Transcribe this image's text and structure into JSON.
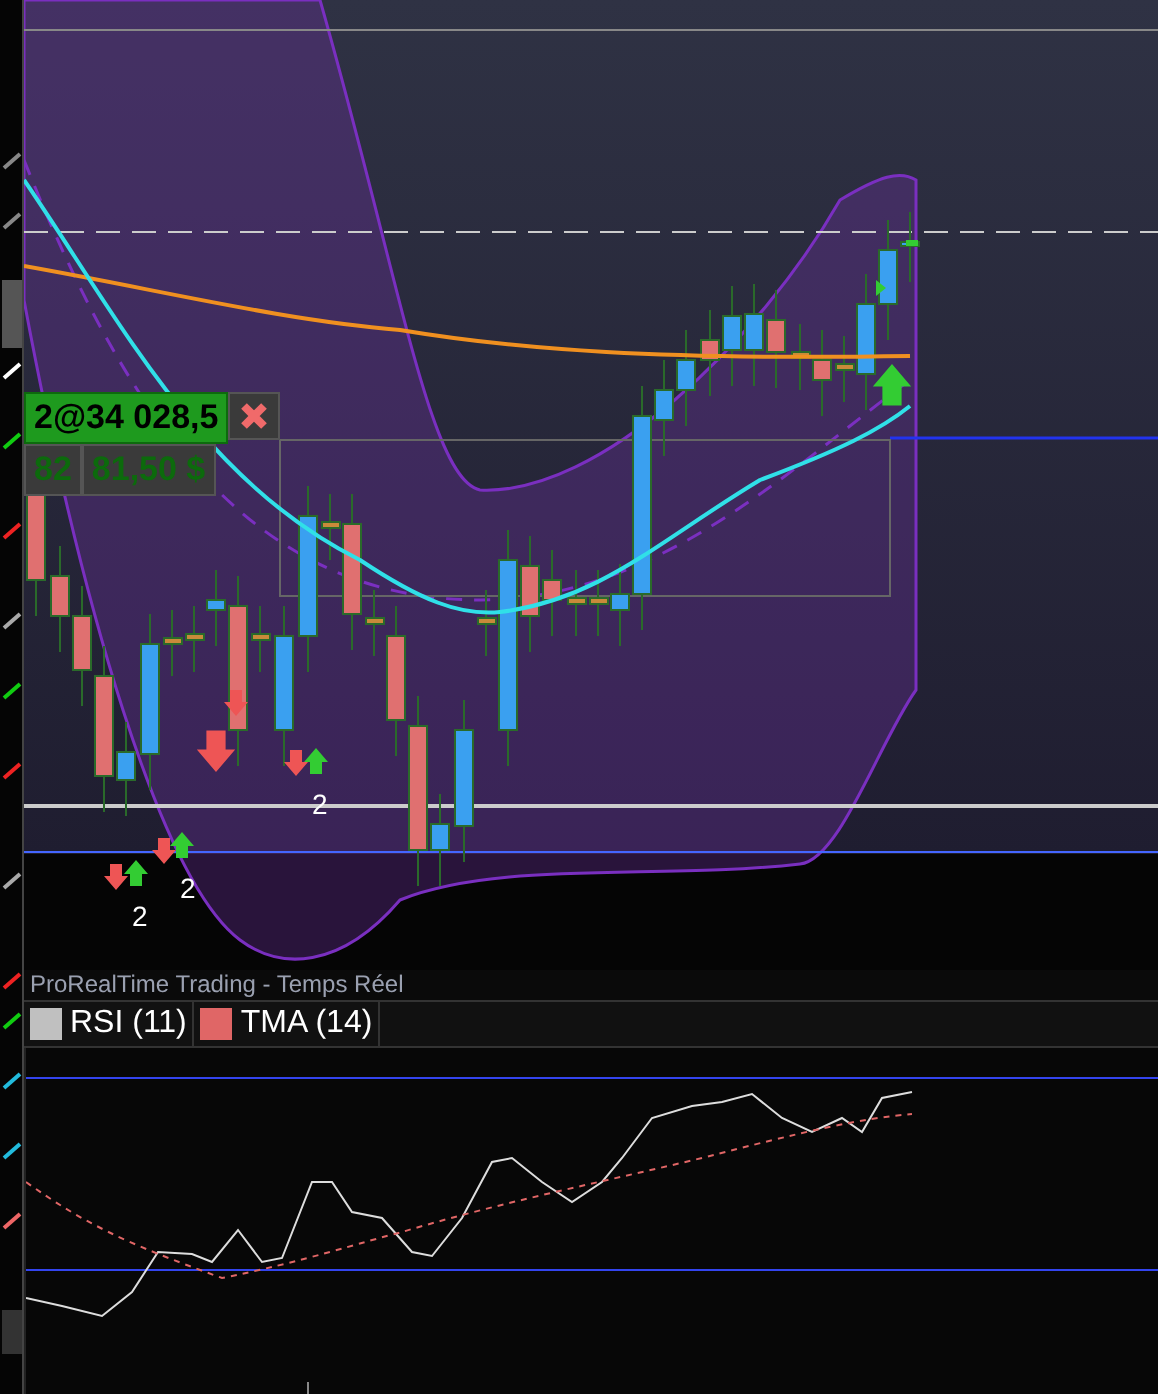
{
  "order_ticket": {
    "order": "2@34 028,5",
    "quantity": "82",
    "profit": "81,50 $"
  },
  "signal_counts": [
    "2",
    "2",
    "2"
  ],
  "indicator_panel": {
    "title": "ProRealTime Trading - Temps Réel",
    "legend": [
      {
        "label": "RSI (11)",
        "color": "#c0c0c0"
      },
      {
        "label": "TMA (14)",
        "color": "#e06666"
      }
    ]
  }
}
